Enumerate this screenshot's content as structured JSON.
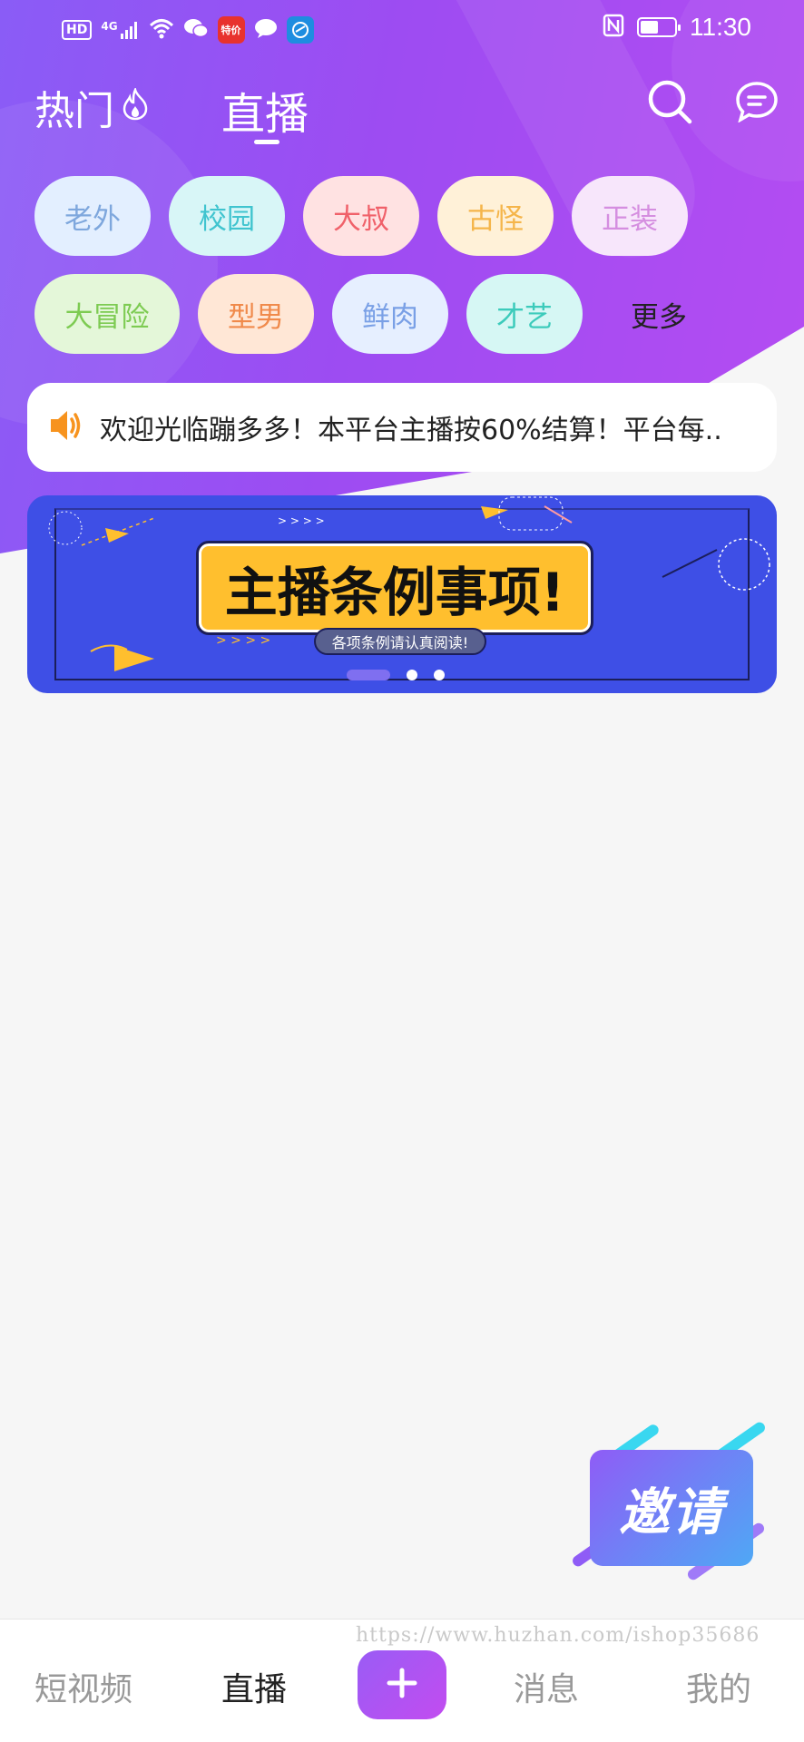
{
  "status_bar": {
    "hd": "HD",
    "network": "4G",
    "app_badge": "特价",
    "time": "11:30"
  },
  "top_nav": {
    "tabs": [
      {
        "label": "热门",
        "icon": "flame-icon"
      },
      {
        "label": "直播",
        "active": true
      }
    ],
    "right_icons": [
      "search-icon",
      "message-bubble-icon"
    ]
  },
  "categories": [
    {
      "label": "老外",
      "bg": "#e3efff",
      "color": "#7ea7dd"
    },
    {
      "label": "校园",
      "bg": "#d8f6f7",
      "color": "#40c4cf"
    },
    {
      "label": "大叔",
      "bg": "#ffe2e2",
      "color": "#f0616a"
    },
    {
      "label": "古怪",
      "bg": "#fff1d8",
      "color": "#f5b54a"
    },
    {
      "label": "正装",
      "bg": "#f7e6fb",
      "color": "#d58ee0"
    },
    {
      "label": "大冒险",
      "bg": "#e4f7d9",
      "color": "#7dcb52"
    },
    {
      "label": "型男",
      "bg": "#ffe7d6",
      "color": "#f08a4b"
    },
    {
      "label": "鲜肉",
      "bg": "#e6efff",
      "color": "#7aa0e6"
    },
    {
      "label": "才艺",
      "bg": "#d6f7f4",
      "color": "#3ccbbb"
    },
    {
      "label": "更多",
      "bg": "transparent",
      "color": "#222222"
    }
  ],
  "notice": {
    "icon": "speaker-icon",
    "text": "欢迎光临蹦多多！本平台主播按60%结算！平台每.."
  },
  "banner": {
    "title": "主播条例事项!",
    "subtitle": "各项条例请认真阅读!",
    "slide_count": 3,
    "active_slide": 0
  },
  "invite": {
    "label": "邀请"
  },
  "watermark": "https://www.huzhan.com/ishop35686",
  "bottom_nav": {
    "items": [
      {
        "label": "短视频"
      },
      {
        "label": "直播",
        "active": true
      },
      {
        "label": "+",
        "icon": "plus-icon"
      },
      {
        "label": "消息"
      },
      {
        "label": "我的"
      }
    ]
  },
  "colors": {
    "header_purple": "#9d4cf2",
    "banner_blue": "#3e4fe6",
    "banner_yellow": "#ffbf2e"
  }
}
